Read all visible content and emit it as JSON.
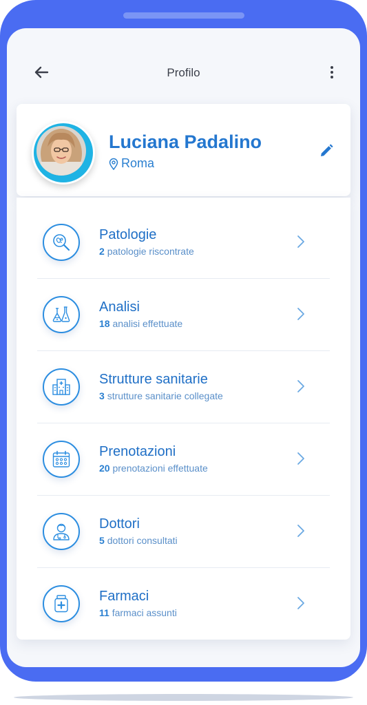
{
  "header": {
    "title": "Profilo",
    "back_icon": "arrow-left-icon",
    "menu_icon": "more-vertical-icon"
  },
  "profile": {
    "name": "Luciana Padalino",
    "location": "Roma",
    "location_icon": "map-pin-icon",
    "edit_icon": "pencil-icon"
  },
  "items": [
    {
      "title": "Patologie",
      "count": "2",
      "subtitle": "patologie riscontrate",
      "icon": "bacteria-magnifier-icon"
    },
    {
      "title": "Analisi",
      "count": "18",
      "subtitle": "analisi effettuate",
      "icon": "lab-flasks-icon"
    },
    {
      "title": "Strutture sanitarie",
      "count": "3",
      "subtitle": "strutture sanitarie collegate",
      "icon": "hospital-building-icon"
    },
    {
      "title": "Prenotazioni",
      "count": "20",
      "subtitle": "prenotazioni effettuate",
      "icon": "calendar-icon"
    },
    {
      "title": "Dottori",
      "count": "5",
      "subtitle": "dottori consultati",
      "icon": "doctor-icon"
    },
    {
      "title": "Farmaci",
      "count": "11",
      "subtitle": "farmaci assunti",
      "icon": "medicine-bottle-icon"
    }
  ],
  "colors": {
    "frame": "#4a6cf2",
    "accent": "#2477cf",
    "avatar_ring": "#1fb3e4"
  }
}
